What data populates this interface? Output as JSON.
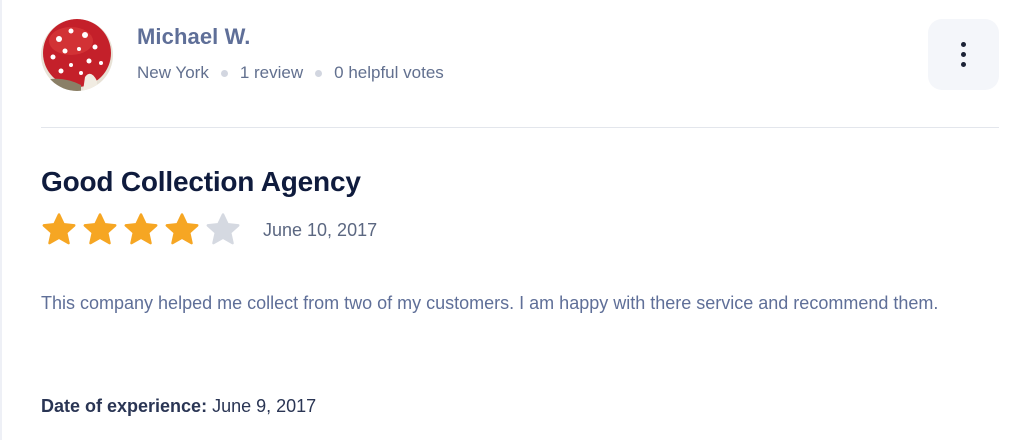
{
  "reviewer": {
    "name": "Michael W.",
    "location": "New York",
    "review_count": "1 review",
    "helpful_votes": "0 helpful votes"
  },
  "review": {
    "title": "Good Collection Agency",
    "rating": 4,
    "rating_max": 5,
    "date": "June 10, 2017",
    "body": "This company helped me collect from two of my customers. I am happy with there service and recommend them.",
    "experience_label": "Date of experience:",
    "experience_date": "June 9, 2017"
  },
  "icons": {
    "more": "more-vertical-icon",
    "star": "star-icon"
  },
  "colors": {
    "star_filled": "#f6a623",
    "star_empty": "#d5d9e1",
    "name": "#5f6f98",
    "title": "#0f1b3d"
  }
}
